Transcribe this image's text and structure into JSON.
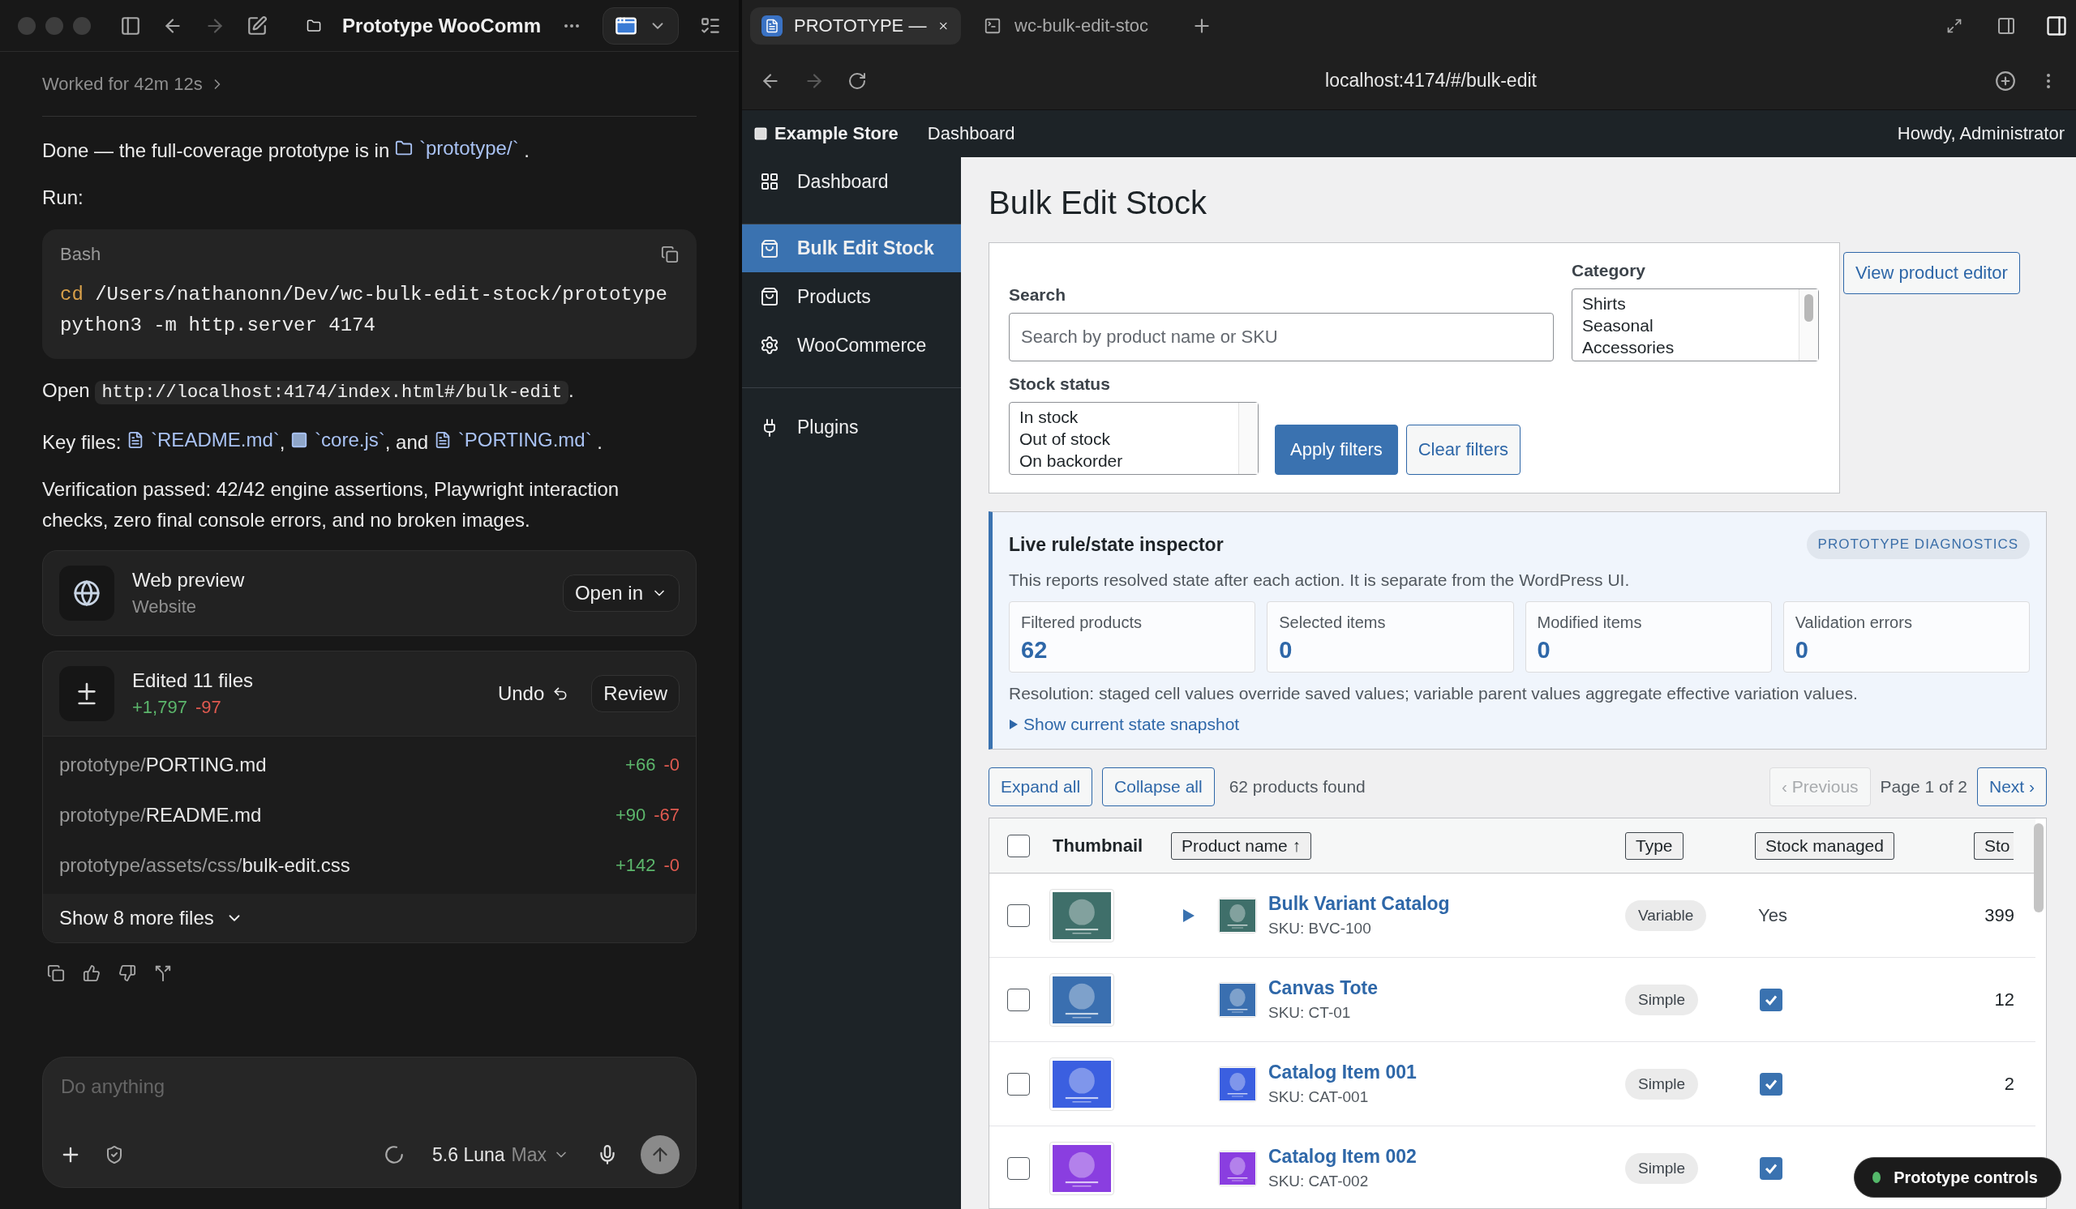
{
  "app_toolbar": {
    "title": "Prototype WooComm"
  },
  "chat": {
    "worked": "Worked for 42m 12s",
    "blocks": [
      {
        "kind": "para",
        "parts": [
          {
            "kind": "text",
            "text": "Done — the full-coverage prototype is in "
          },
          {
            "kind": "folder_link",
            "text": "`prototype/`"
          },
          {
            "kind": "text",
            "text": " ."
          }
        ]
      },
      {
        "kind": "para",
        "parts": [
          {
            "kind": "text",
            "text": "Run:"
          }
        ]
      },
      {
        "kind": "code",
        "label": "Bash",
        "lines": [
          {
            "keyword": "cd",
            "text": " /Users/nathanonn/Dev/wc-bulk-edit-stock/prototype"
          },
          {
            "text": "python3 -m http.server 4174"
          }
        ]
      },
      {
        "kind": "para",
        "parts": [
          {
            "kind": "text",
            "text": "Open "
          },
          {
            "kind": "code",
            "text": "http://localhost:4174/index.html#/bulk-edit"
          },
          {
            "kind": "text",
            "text": "."
          }
        ]
      },
      {
        "kind": "para",
        "parts": [
          {
            "kind": "text",
            "text": "Key files: "
          },
          {
            "kind": "doc_link",
            "text": "`README.md`"
          },
          {
            "kind": "text",
            "text": ", "
          },
          {
            "kind": "js_link",
            "text": "`core.js`"
          },
          {
            "kind": "text",
            "text": ", and "
          },
          {
            "kind": "doc_link",
            "text": "`PORTING.md`"
          },
          {
            "kind": "text",
            "text": " ."
          }
        ]
      },
      {
        "kind": "para",
        "parts": [
          {
            "kind": "text",
            "text": "Verification passed: 42/42 engine assertions, Playwright interaction checks, zero final console errors, and no broken images."
          }
        ]
      }
    ],
    "preview": {
      "title": "Web preview",
      "subtitle": "Website",
      "button": "Open in"
    },
    "edits": {
      "title": "Edited 11 files",
      "added": "+1,797",
      "removed": "-97",
      "undo": "Undo",
      "review": "Review",
      "files": [
        {
          "dir": "prototype/",
          "name": "PORTING.md",
          "added": "+66",
          "removed": "-0"
        },
        {
          "dir": "prototype/",
          "name": "README.md",
          "added": "+90",
          "removed": "-67"
        },
        {
          "dir": "prototype/assets/css/",
          "name": "bulk-edit.css",
          "added": "+142",
          "removed": "-0"
        }
      ],
      "more": "Show 8 more files"
    },
    "composer": {
      "placeholder": "Do anything",
      "model": "5.6 Luna",
      "effort": "Max"
    }
  },
  "browser": {
    "tabs": [
      {
        "title": "PROTOTYPE —",
        "kind": "page",
        "selected": true
      },
      {
        "title": "wc-bulk-edit-stoc",
        "kind": "terminal",
        "selected": false
      }
    ],
    "url": "localhost:4174/#/bulk-edit"
  },
  "admin_bar": {
    "site": "Example Store",
    "link": "Dashboard",
    "greeting": "Howdy, Administrator"
  },
  "sidebar": {
    "items": [
      {
        "label": "Dashboard",
        "kind": "dashboard",
        "separator_before": false,
        "selected": false
      },
      {
        "label": "Bulk Edit Stock",
        "kind": "bag",
        "separator_before": true,
        "selected": true
      },
      {
        "label": "Products",
        "kind": "bag",
        "separator_before": false,
        "selected": false
      },
      {
        "label": "WooCommerce",
        "kind": "gear",
        "separator_before": false,
        "selected": false
      },
      {
        "label": "Plugins",
        "kind": "plug",
        "separator_before": true,
        "selected": false
      }
    ]
  },
  "page": {
    "title": "Bulk Edit Stock",
    "filters": {
      "search_label": "Search",
      "search_placeholder": "Search by product name or SKU",
      "category_label": "Category",
      "categories": [
        "Shirts",
        "Seasonal",
        "Accessories"
      ],
      "stock_label": "Stock status",
      "stock_options": [
        "In stock",
        "Out of stock",
        "On backorder"
      ],
      "apply": "Apply filters",
      "clear": "Clear filters"
    },
    "editor_button": "View product editor",
    "inspector": {
      "title": "Live rule/state inspector",
      "badge": "PROTOTYPE DIAGNOSTICS",
      "description": "This reports resolved state after each action. It is separate from the WordPress UI.",
      "stats": [
        {
          "label": "Filtered products",
          "value": "62"
        },
        {
          "label": "Selected items",
          "value": "0"
        },
        {
          "label": "Modified items",
          "value": "0"
        },
        {
          "label": "Validation errors",
          "value": "0"
        }
      ],
      "resolution": "Resolution: staged cell values override saved values; variable parent values aggregate effective variation values.",
      "snapshot": "Show current state snapshot"
    },
    "toolbar": {
      "expand": "Expand all",
      "collapse": "Collapse all",
      "count": "62 products found",
      "previous": {
        "label": "‹ Previous",
        "disabled": true
      },
      "page": "Page 1 of 2",
      "next": {
        "label": "Next ›",
        "disabled": false
      }
    },
    "table": {
      "all_selected": false,
      "columns": [
        {
          "label": "Thumbnail",
          "kind": "plain"
        },
        {
          "label": "Product name ↑",
          "kind": "button"
        },
        {
          "label": "Type",
          "kind": "button"
        },
        {
          "label": "Stock managed",
          "kind": "button"
        },
        {
          "label": "Sto",
          "kind": "button"
        }
      ],
      "rows": [
        {
          "selected": false,
          "name": "Bulk Variant Catalog",
          "sku": "SKU: BVC-100",
          "type": "Variable",
          "expandable": true,
          "expanded": false,
          "stock_managed": {
            "kind": "text",
            "text": "Yes"
          },
          "stock": "399"
        },
        {
          "selected": false,
          "name": "Canvas Tote",
          "sku": "SKU: CT-01",
          "type": "Simple",
          "expandable": false,
          "stock_managed": {
            "kind": "checkbox",
            "checked": true
          },
          "stock": "12"
        },
        {
          "selected": false,
          "name": "Catalog Item 001",
          "sku": "SKU: CAT-001",
          "type": "Simple",
          "expandable": false,
          "stock_managed": {
            "kind": "checkbox",
            "checked": true
          },
          "stock": "2"
        },
        {
          "selected": false,
          "name": "Catalog Item 002",
          "sku": "SKU: CAT-002",
          "type": "Simple",
          "expandable": false,
          "stock_managed": {
            "kind": "checkbox",
            "checked": true
          }
        }
      ]
    }
  },
  "floating": {
    "label": "Prototype controls"
  }
}
